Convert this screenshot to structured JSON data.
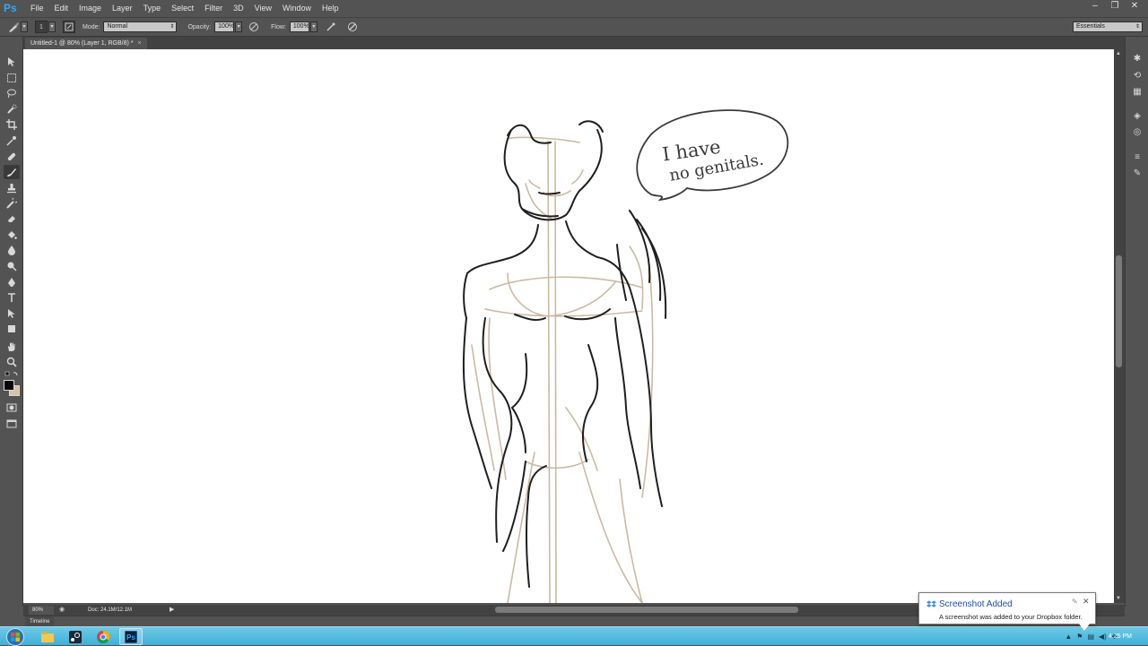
{
  "app": {
    "logo": "Ps"
  },
  "menu": [
    "File",
    "Edit",
    "Image",
    "Layer",
    "Type",
    "Select",
    "Filter",
    "3D",
    "View",
    "Window",
    "Help"
  ],
  "window_controls": {
    "minimize": "–",
    "restore": "❐",
    "close": "✕"
  },
  "options": {
    "brush_size": "1",
    "mode_label": "Mode:",
    "mode_value": "Normal",
    "opacity_label": "Opacity:",
    "opacity_value": "100%",
    "flow_label": "Flow:",
    "flow_value": "100%",
    "workspace": "Essentials"
  },
  "document": {
    "tab_title": "Untitled-1 @ 80% (Layer 1, RGB/8) *",
    "tab_close": "×"
  },
  "status": {
    "zoom": "80%",
    "doc_info": "Doc: 24.1M/12.1M"
  },
  "timeline": {
    "label": "Timeline"
  },
  "canvas": {
    "speech_line1": "I have",
    "speech_line2": "no genitals."
  },
  "notification": {
    "title": "Screenshot Added",
    "text": "A screenshot was added to your Dropbox folder."
  },
  "taskbar": {
    "clock": "4:25 PM"
  },
  "colors": {
    "ui_bg": "#535353",
    "canvas_bg": "#ffffff",
    "taskbar": "#3fb0d8",
    "sketch_dark": "#1f1f1f",
    "sketch_tan": "#c9b8a4"
  }
}
